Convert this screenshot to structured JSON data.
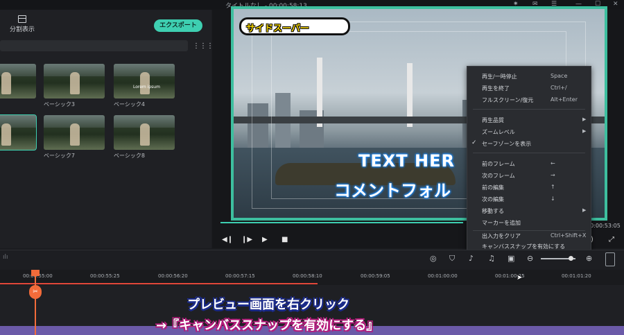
{
  "window": {
    "title": "タイトルなし - 00:00:58:13"
  },
  "left_panel": {
    "split_view_label": "分割表示",
    "export_label": "エクスポート",
    "thumbnails": [
      {
        "label": ""
      },
      {
        "label": "ベーシック3"
      },
      {
        "label": "ベーシック4",
        "overlay_text": "Lorem ipsum"
      },
      {
        "label": ""
      },
      {
        "label": "ベーシック7"
      },
      {
        "label": "ベーシック8"
      }
    ]
  },
  "preview": {
    "title_badge": "サイドスーパー",
    "text_here": "TEXT HER",
    "comment_text": "コメントフォル",
    "timecode": "00:00:53:05",
    "progress": 0.59
  },
  "context_menu": {
    "items": [
      {
        "label": "再生/一時停止",
        "shortcut": "Space"
      },
      {
        "label": "再生を終了",
        "shortcut": "Ctrl+/"
      },
      {
        "label": "フルスクリーン/復元",
        "shortcut": "Alt+Enter"
      },
      {
        "label": "再生品質",
        "submenu": true
      },
      {
        "label": "ズームレベル",
        "submenu": true
      },
      {
        "label": "セーフゾーンを表示",
        "checked": true
      },
      {
        "label": "前のフレーム",
        "shortcut": "←"
      },
      {
        "label": "次のフレーム",
        "shortcut": "→"
      },
      {
        "label": "前の編集",
        "shortcut": "↑"
      },
      {
        "label": "次の編集",
        "shortcut": "↓"
      },
      {
        "label": "移動する",
        "submenu": true
      },
      {
        "label": "マーカーを追加"
      },
      {
        "label": "出入力をクリア",
        "shortcut": "Ctrl+Shift+X"
      },
      {
        "label": "キャンバススナップを有効にする"
      }
    ]
  },
  "timeline": {
    "ticks": [
      "00:00:55:00",
      "00:00:55:25",
      "00:00:56:20",
      "00:00:57:15",
      "00:00:58:10",
      "00:00:59:05",
      "00:01:00:00",
      "00:01:00:25",
      "00:01:01:20"
    ]
  },
  "caption": {
    "line1": "プレビュー画面を右クリック",
    "line2": "→『キャンバススナップを有効にする』"
  },
  "colors": {
    "accent": "#3ecfb1",
    "playhead": "#f26b3a"
  }
}
